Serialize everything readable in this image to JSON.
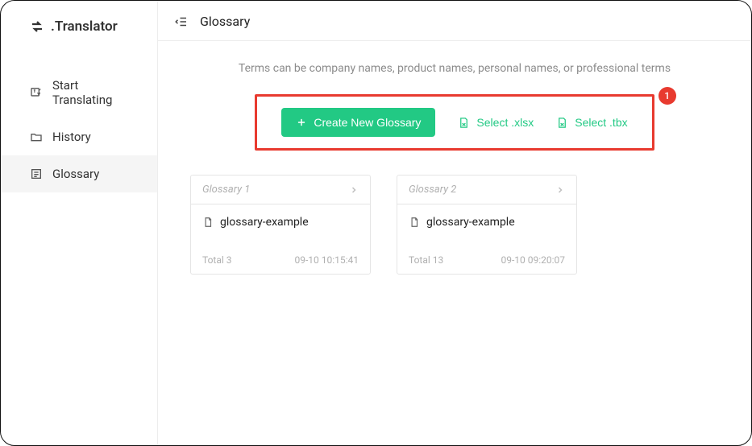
{
  "app": {
    "title": ".Translator"
  },
  "sidebar": {
    "items": [
      {
        "label": "Start Translating"
      },
      {
        "label": "History"
      },
      {
        "label": "Glossary"
      }
    ]
  },
  "header": {
    "title": "Glossary"
  },
  "hint": "Terms can be company names, product names, personal names, or professional terms",
  "actions": {
    "create": "Create New Glossary",
    "select_xlsx": "Select .xlsx",
    "select_tbx": "Select .tbx",
    "step_badge": "1"
  },
  "glossaries": [
    {
      "title": "Glossary 1",
      "file": "glossary-example",
      "total_label": "Total 3",
      "timestamp": "09-10 10:15:41"
    },
    {
      "title": "Glossary 2",
      "file": "glossary-example",
      "total_label": "Total 13",
      "timestamp": "09-10 09:20:07"
    }
  ]
}
